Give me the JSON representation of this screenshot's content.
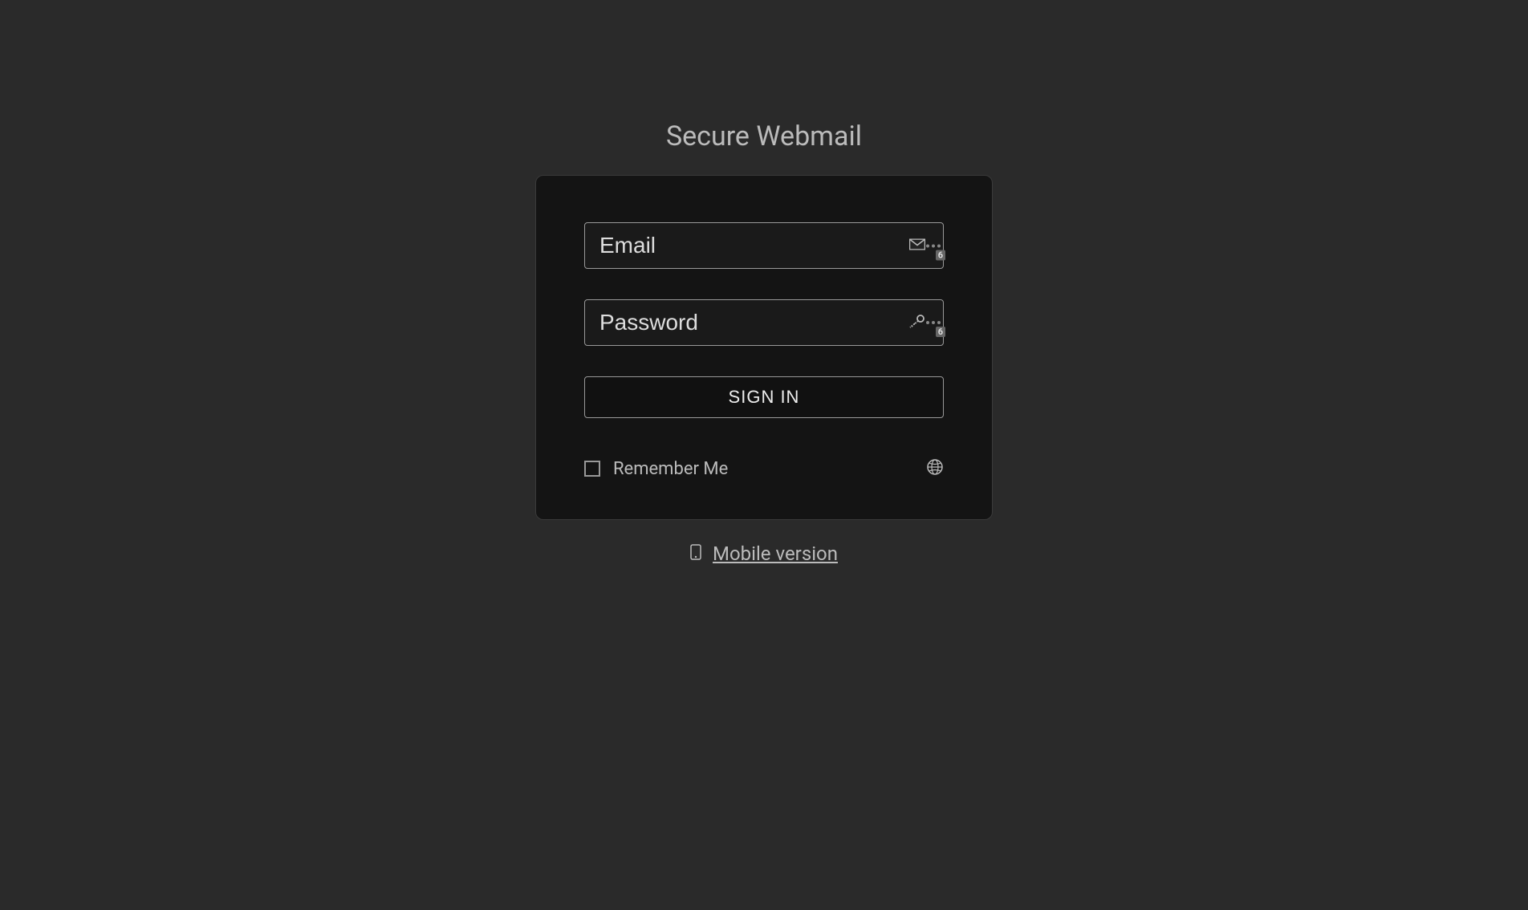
{
  "title": "Secure Webmail",
  "form": {
    "email_placeholder": "Email",
    "password_placeholder": "Password",
    "signin_label": "SIGN IN",
    "remember_label": "Remember Me",
    "autofill_badge": "6"
  },
  "footer": {
    "mobile_link_label": "Mobile version"
  }
}
